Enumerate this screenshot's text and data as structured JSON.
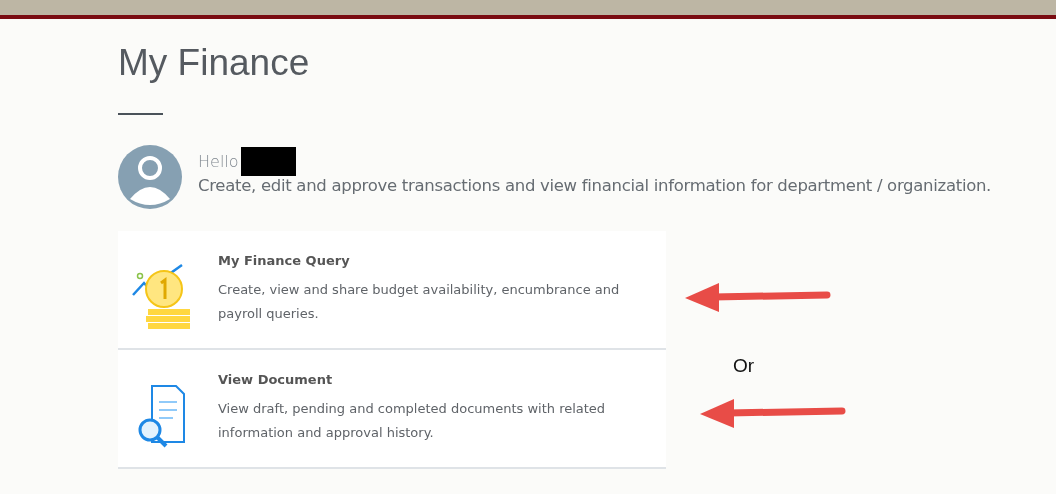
{
  "page": {
    "title": "My Finance"
  },
  "greeting": {
    "hello": "Hello",
    "name_redacted": true,
    "description": "Create, edit and approve transactions and view financial information for department / organization."
  },
  "cards": [
    {
      "kind": "coin",
      "title": "My Finance Query",
      "description": "Create, view and share budget availability, encumbrance and payroll queries."
    },
    {
      "kind": "document",
      "title": "View Document",
      "description": "View draft, pending and completed documents with related information and approval history."
    }
  ],
  "annotation": {
    "label": "Or"
  }
}
